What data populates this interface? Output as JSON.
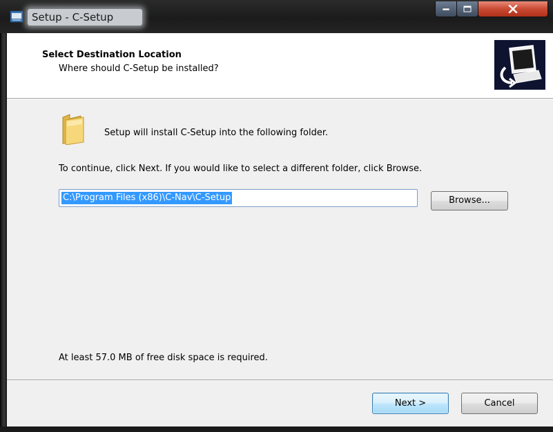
{
  "window": {
    "title": "Setup - C-Setup"
  },
  "header": {
    "title": "Select Destination Location",
    "subtitle": "Where should C-Setup be installed?"
  },
  "body": {
    "intro": "Setup will install C-Setup into the following folder.",
    "instructions": "To continue, click Next. If you would like to select a different folder, click Browse.",
    "path_value": "C:\\Program Files (x86)\\C-Nav\\C-Setup",
    "browse_label": "Browse...",
    "space_required": "At least 57.0 MB of free disk space is required."
  },
  "footer": {
    "next_label": "Next >",
    "cancel_label": "Cancel"
  },
  "icons": {
    "app": "setup-app-icon",
    "folder": "folder-icon",
    "logo": "computer-install-logo"
  },
  "colors": {
    "selection": "#3399ff",
    "close_button": "#c94a32",
    "header_logo_bg": "#0e1430"
  }
}
